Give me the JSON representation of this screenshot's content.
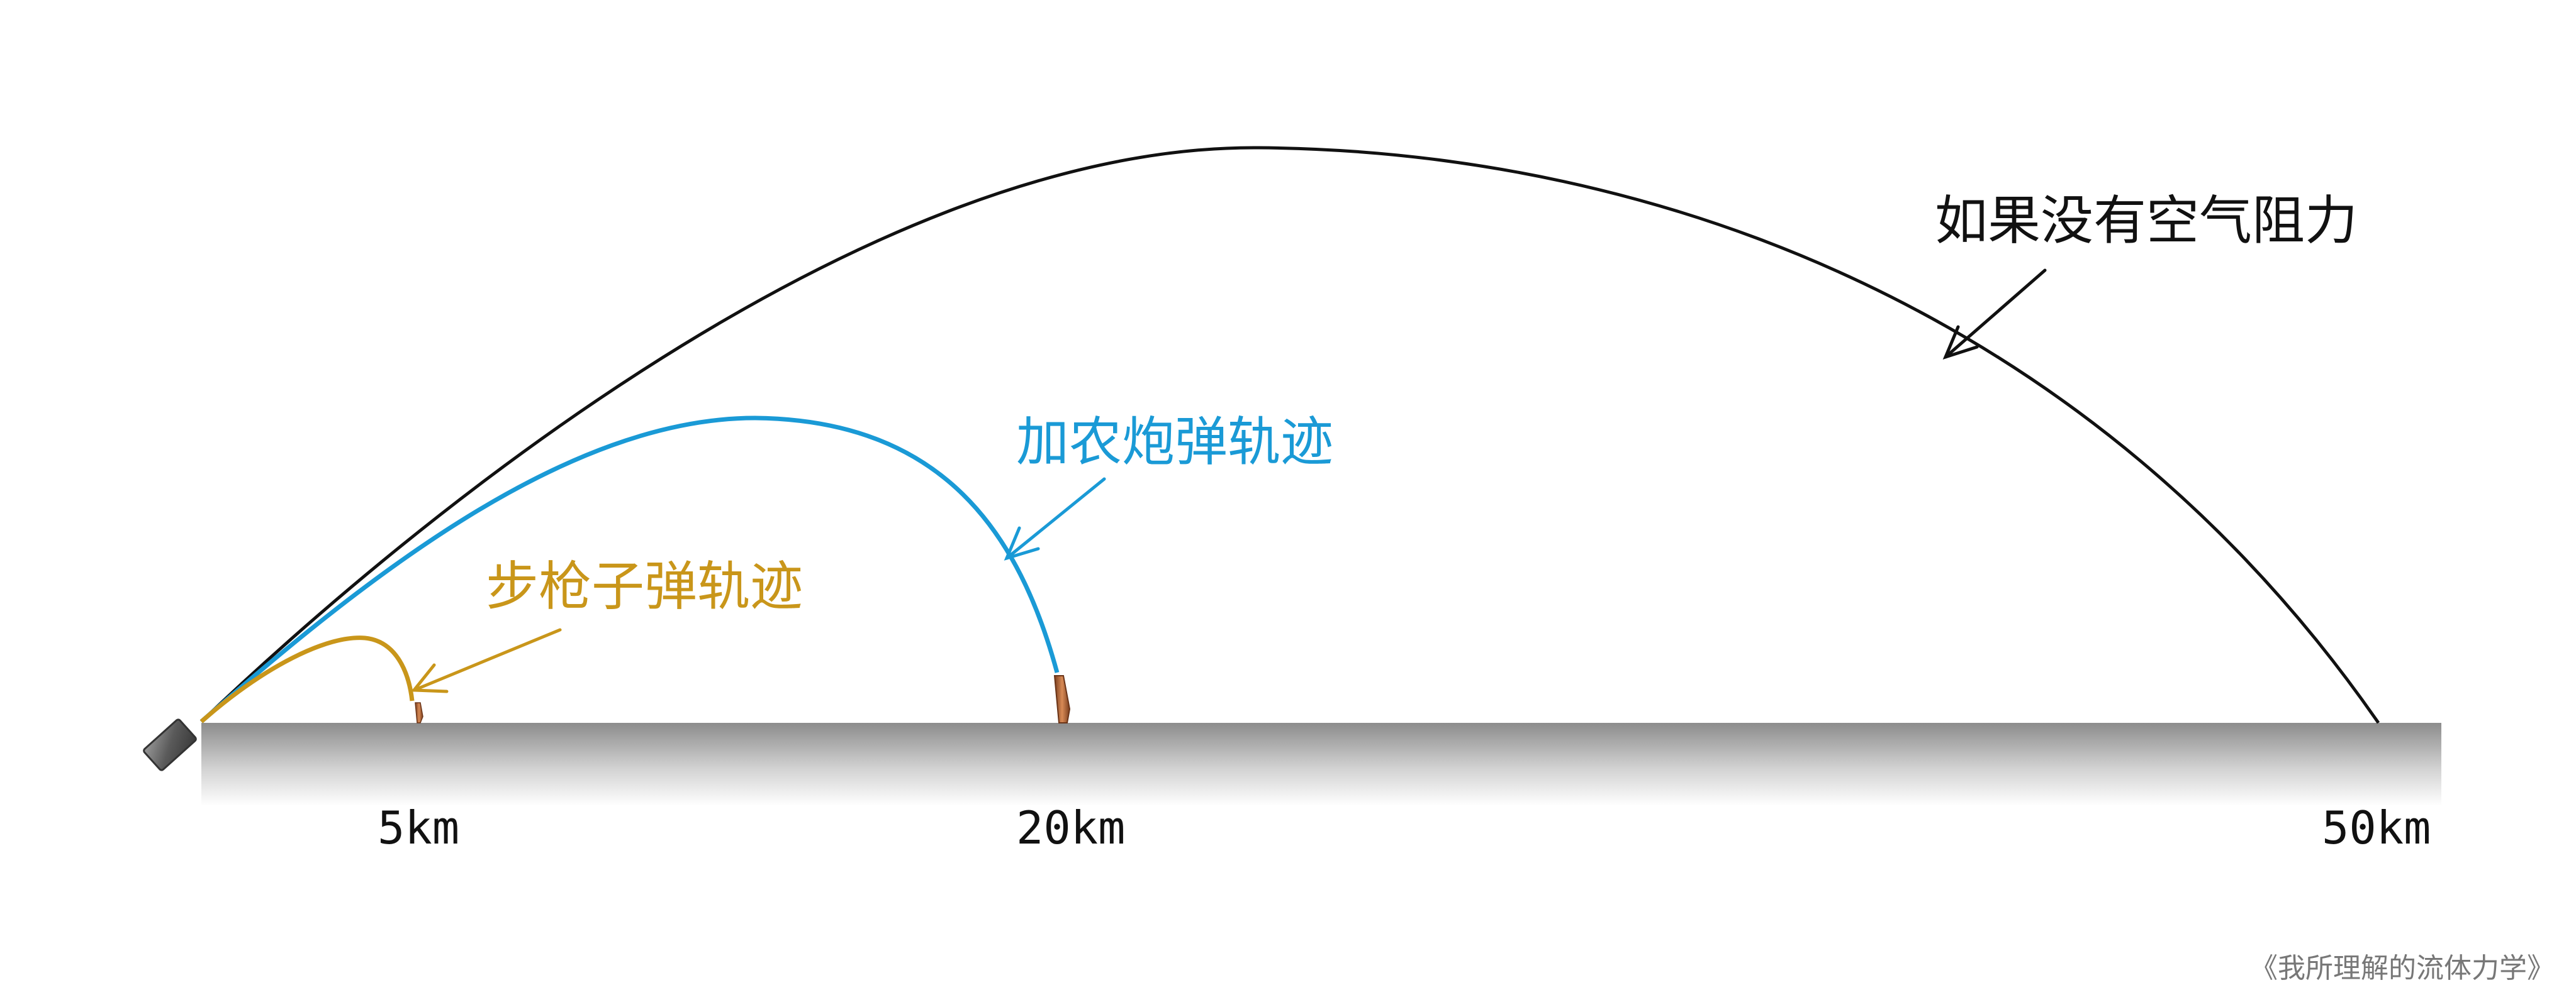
{
  "colors": {
    "no_air_resistance": "#111111",
    "cannon": "#1a9ad6",
    "rifle": "#c9961a",
    "ground_top": "#8c8c8c",
    "bullet": "#b06a3b",
    "muzzle": "#707070"
  },
  "labels": {
    "no_air_resistance": "如果没有空气阻力",
    "cannon": "加农炮弹轨迹",
    "rifle": "步枪子弹轨迹"
  },
  "distances": {
    "d1": "5km",
    "d2": "20km",
    "d3": "50km"
  },
  "caption": "《我所理解的流体力学》"
}
